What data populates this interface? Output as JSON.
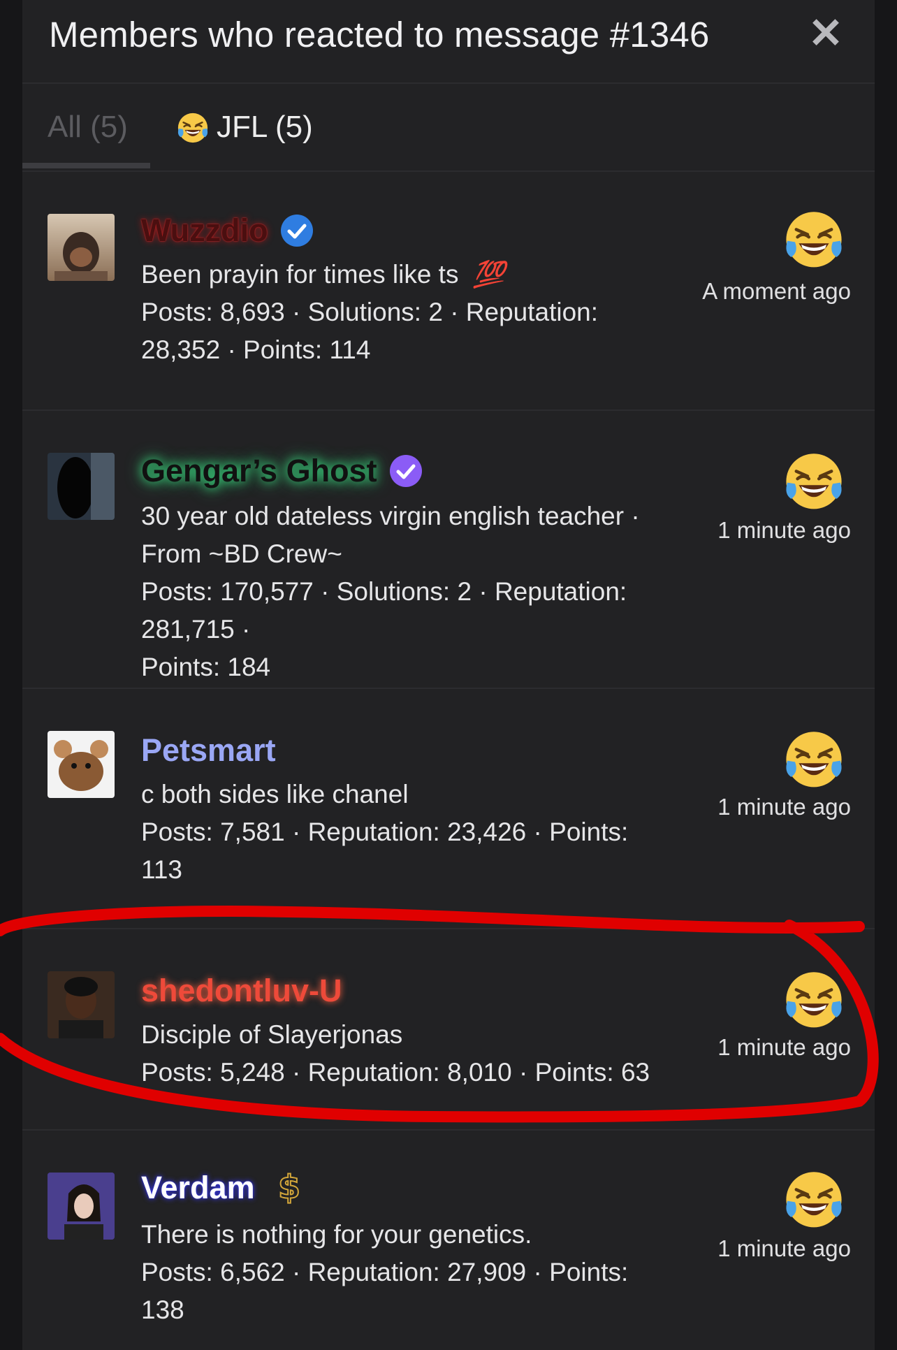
{
  "header": {
    "title": "Members who reacted to message #1346",
    "close_glyph": "✕"
  },
  "tabs": [
    {
      "label": "All (5)",
      "active": true
    },
    {
      "label": "JFL (5)",
      "icon": "crying-laughing-emoji-icon"
    }
  ],
  "members": [
    {
      "name": "Wuzzdio",
      "name_color": "#4a0f10",
      "badge": "verified-blue-icon",
      "bio": "Been prayin for times like ts",
      "bio_emoji": "💯",
      "stats_line1": "Posts: 8,693 · Solutions: 2 · Reputation:",
      "stats_line2": "28,352 · Points: 114",
      "time": "A moment ago"
    },
    {
      "name": "Gengar’s Ghost",
      "name_color": "#111111",
      "badge": "verified-purple-icon",
      "bio": "30 year old dateless virgin english teacher ·",
      "bio2": "From ~BD Crew~",
      "stats_line1": "Posts: 170,577 · Solutions: 2 · Reputation: 281,715 ·",
      "stats_line2": "Points: 184",
      "time": "1 minute ago"
    },
    {
      "name": "Petsmart",
      "name_color": "#9aa7f5",
      "bio": "c both sides like chanel",
      "stats_line1": "Posts: 7,581 · Reputation: 23,426 · Points:",
      "stats_line2": "113",
      "time": "1 minute ago"
    },
    {
      "name": "shedontluv-U",
      "name_color": "#ee4a3a",
      "bio": "Disciple of Slayerjonas",
      "stats_line1": "Posts: 5,248 · Reputation: 8,010 · Points: 63",
      "time": "1 minute ago"
    },
    {
      "name": "Verdam",
      "name_color": "#ffffff",
      "badge": "dollar-icon",
      "bio": "There is nothing for your genetics.",
      "stats_line1": "Posts: 6,562 · Reputation: 27,909 · Points:",
      "stats_line2": "138",
      "time": "1 minute ago"
    }
  ],
  "colors": {
    "panel": "#222224",
    "annotation": "#e00000"
  }
}
